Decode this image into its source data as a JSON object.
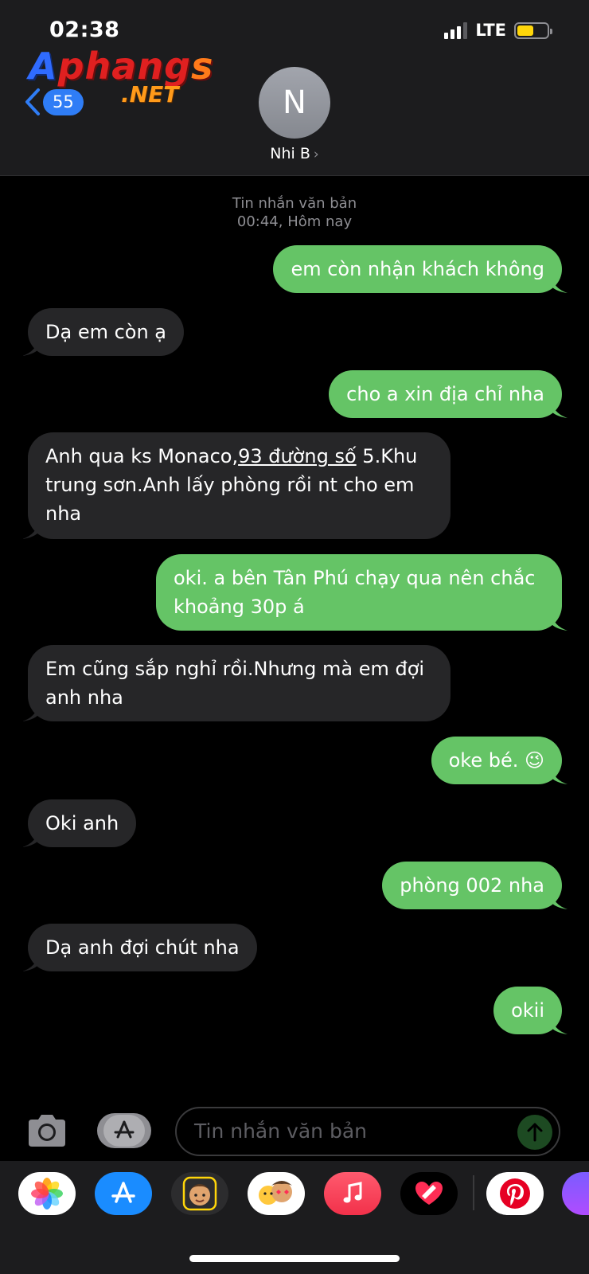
{
  "status_bar": {
    "time": "02:38",
    "network": "LTE",
    "battery_color": "#ffd60a"
  },
  "watermark": {
    "main": "Aphangs",
    "suffix": ".NET"
  },
  "header": {
    "back_count": "55",
    "contact_initial": "N",
    "contact_name": "Nhi B",
    "chevron": "›"
  },
  "conversation": {
    "timestamp_label": "Tin nhắn văn bản",
    "timestamp_time": "00:44, Hôm nay",
    "messages": [
      {
        "dir": "out",
        "text": "em còn nhận khách không"
      },
      {
        "dir": "in",
        "text": "Dạ em còn ạ"
      },
      {
        "dir": "out",
        "text": "cho a xin địa chỉ nha"
      },
      {
        "dir": "in",
        "pre": "Anh qua ks Monaco,",
        "link": "93 đường số",
        "post": " 5.Khu trung sơn.Anh lấy phòng rồi nt cho em nha"
      },
      {
        "dir": "out",
        "text": "oki. a bên Tân Phú chạy qua nên chắc khoảng 30p á"
      },
      {
        "dir": "in",
        "text": "Em cũng sắp nghỉ rồi.Nhưng mà em đợi anh nha"
      },
      {
        "dir": "out",
        "text": "oke bé. 😉"
      },
      {
        "dir": "in",
        "text": "Oki anh"
      },
      {
        "dir": "out",
        "text": "phòng 002 nha"
      },
      {
        "dir": "in",
        "text": "Dạ anh đợi chút nha"
      },
      {
        "dir": "out",
        "text": "okii"
      }
    ]
  },
  "composer": {
    "placeholder": "Tin nhắn văn bản"
  },
  "drawer": {
    "apps": [
      "photos-icon",
      "app-store-icon",
      "memoji-icon",
      "animoji-icon",
      "music-icon",
      "digital-touch-icon",
      "pinterest-icon",
      "more-app-icon"
    ]
  },
  "colors": {
    "outgoing": "#65c466",
    "incoming": "#262628",
    "accent": "#2f7df6"
  }
}
